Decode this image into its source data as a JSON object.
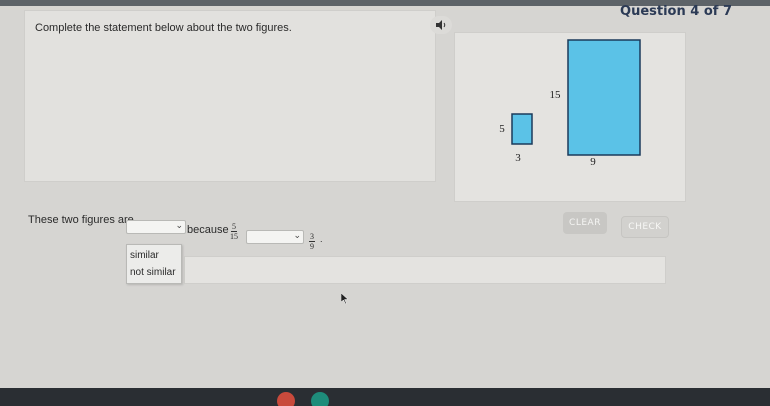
{
  "header": {
    "question_counter": "Question 4 of 7"
  },
  "prompt": {
    "text": "Complete the statement below about the two figures.",
    "speaker_icon": "speaker-icon"
  },
  "figures": {
    "small": {
      "height_label": "5",
      "width_label": "3"
    },
    "large": {
      "height_label": "15",
      "width_label": "9"
    },
    "fill_color": "#5bc2e7",
    "stroke_color": "#1b3a5a"
  },
  "statement": {
    "prefix": "These two figures are",
    "middle": "because",
    "fraction_left": {
      "numerator": "5",
      "denominator": "15"
    },
    "fraction_right": {
      "numerator": "3",
      "denominator": "9"
    },
    "end": "."
  },
  "dropdown": {
    "options": [
      "similar",
      "not similar"
    ]
  },
  "buttons": {
    "clear": "CLEAR",
    "check": "CHECK"
  }
}
